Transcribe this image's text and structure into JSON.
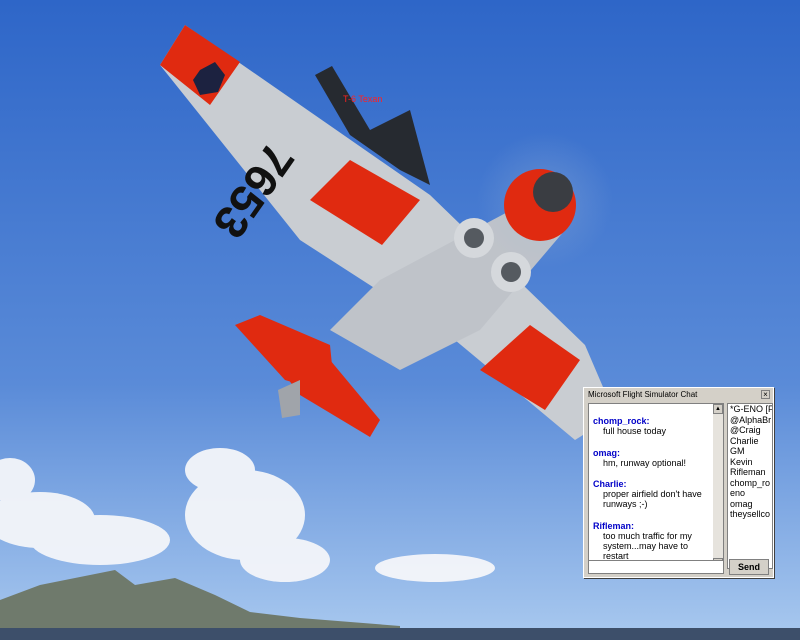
{
  "aircraft_label": "T-6 Texan",
  "tail_number": "7653",
  "chat": {
    "title": "Microsoft Flight Simulator Chat",
    "close_symbol": "×",
    "messages": [
      {
        "sender": "chomp_rock:",
        "text": [
          "full house today"
        ]
      },
      {
        "sender": "omag:",
        "text": [
          "hm, runway optional!"
        ]
      },
      {
        "sender": "Charlie:",
        "text": [
          "proper airfield don't have",
          "runways ;-)"
        ]
      },
      {
        "sender": "Rifleman:",
        "text": [
          "too much traffic for my",
          "system...may have to",
          "restart"
        ]
      }
    ],
    "users": [
      "*G-ENO [F",
      "@AlphaBr",
      "@Craig",
      "Charlie",
      "GM",
      "Kevin",
      "Rifleman",
      "chomp_ro",
      "eno",
      "omag",
      "theysellco"
    ],
    "input_value": "",
    "send_label": "Send"
  },
  "colors": {
    "sky_top": "#2f68c9",
    "sky_bottom": "#9ec2ee",
    "aircraft_red": "#e02a10",
    "aircraft_silver": "#c9cdd2",
    "chat_name": "#0000c8",
    "label_red": "#ff2020"
  }
}
